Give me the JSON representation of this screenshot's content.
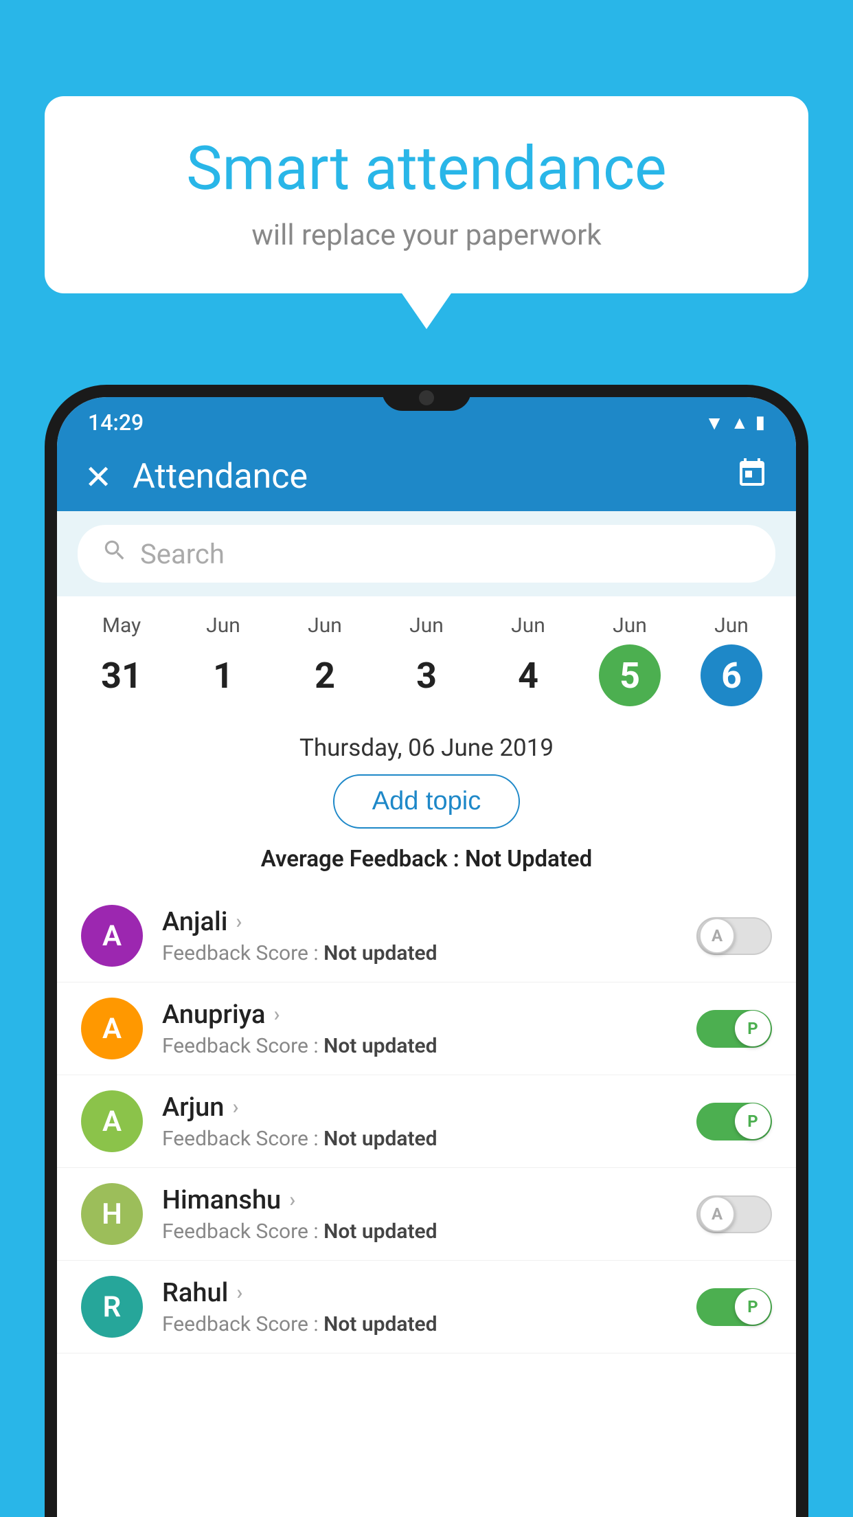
{
  "background_color": "#29b6e8",
  "bubble": {
    "title": "Smart attendance",
    "subtitle": "will replace your paperwork"
  },
  "status_bar": {
    "time": "14:29",
    "wifi_icon": "▼",
    "signal_icon": "▲",
    "battery_icon": "▮"
  },
  "header": {
    "title": "Attendance",
    "close_label": "✕",
    "calendar_icon": "📅"
  },
  "search": {
    "placeholder": "Search"
  },
  "calendar": {
    "days": [
      {
        "month": "May",
        "num": "31",
        "state": "normal"
      },
      {
        "month": "Jun",
        "num": "1",
        "state": "normal"
      },
      {
        "month": "Jun",
        "num": "2",
        "state": "normal"
      },
      {
        "month": "Jun",
        "num": "3",
        "state": "normal"
      },
      {
        "month": "Jun",
        "num": "4",
        "state": "normal"
      },
      {
        "month": "Jun",
        "num": "5",
        "state": "today"
      },
      {
        "month": "Jun",
        "num": "6",
        "state": "selected"
      }
    ]
  },
  "selected_date": "Thursday, 06 June 2019",
  "add_topic_label": "Add topic",
  "average_feedback_label": "Average Feedback :",
  "average_feedback_value": "Not Updated",
  "students": [
    {
      "name": "Anjali",
      "avatar_letter": "A",
      "avatar_color": "purple",
      "feedback_label": "Feedback Score :",
      "feedback_value": "Not updated",
      "attendance": "absent",
      "toggle_letter": "A"
    },
    {
      "name": "Anupriya",
      "avatar_letter": "A",
      "avatar_color": "orange",
      "feedback_label": "Feedback Score :",
      "feedback_value": "Not updated",
      "attendance": "present",
      "toggle_letter": "P"
    },
    {
      "name": "Arjun",
      "avatar_letter": "A",
      "avatar_color": "green",
      "feedback_label": "Feedback Score :",
      "feedback_value": "Not updated",
      "attendance": "present",
      "toggle_letter": "P"
    },
    {
      "name": "Himanshu",
      "avatar_letter": "H",
      "avatar_color": "olive",
      "feedback_label": "Feedback Score :",
      "feedback_value": "Not updated",
      "attendance": "absent",
      "toggle_letter": "A"
    },
    {
      "name": "Rahul",
      "avatar_letter": "R",
      "avatar_color": "teal",
      "feedback_label": "Feedback Score :",
      "feedback_value": "Not updated",
      "attendance": "present",
      "toggle_letter": "P"
    }
  ]
}
